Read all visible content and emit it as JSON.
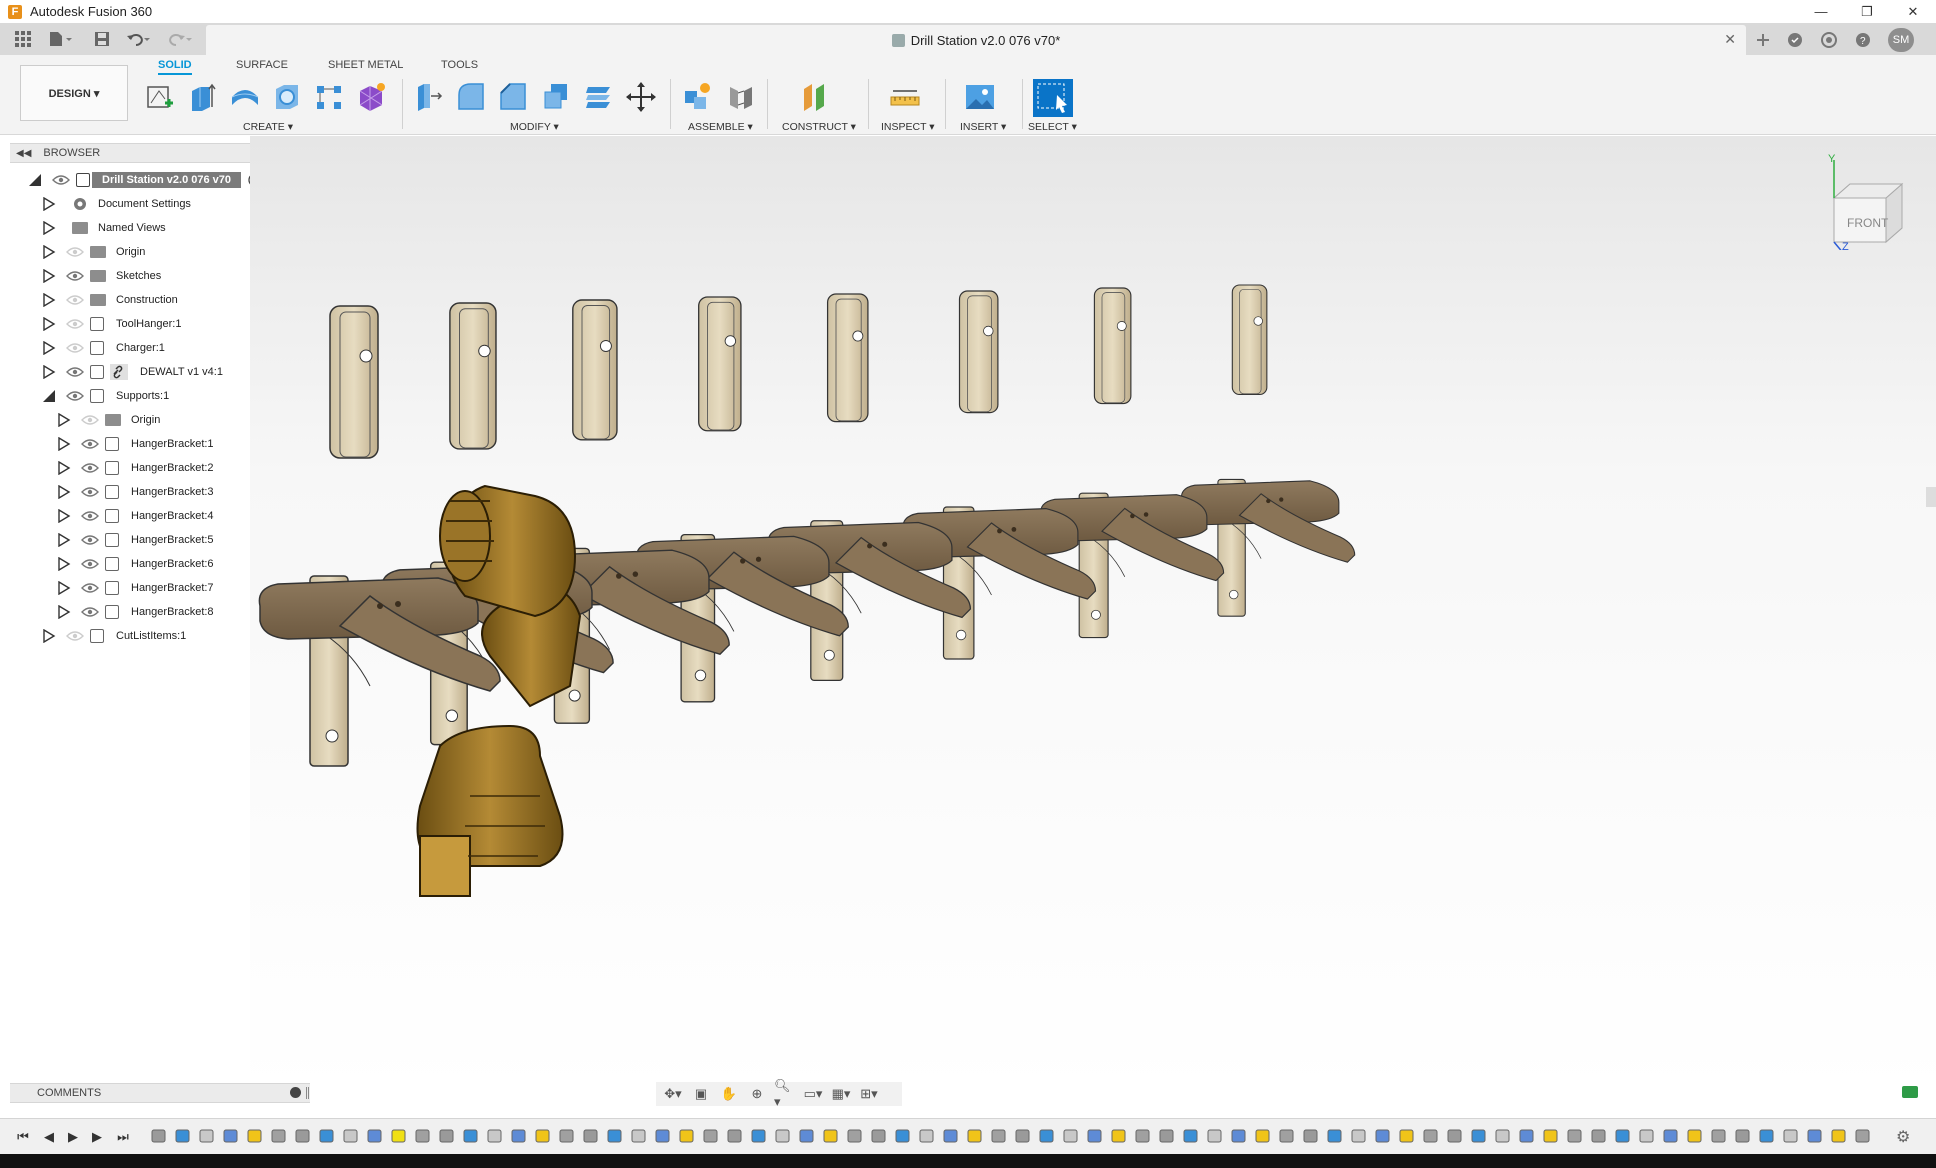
{
  "app": {
    "title": "Autodesk Fusion 360",
    "logo_letter": "F"
  },
  "document": {
    "title": "Drill Station v2.0 076 v70*",
    "close_glyph": "✕"
  },
  "user": {
    "initials": "SM"
  },
  "ribbon": {
    "workspace": "DESIGN ▾",
    "tabs": [
      "SOLID",
      "SURFACE",
      "SHEET METAL",
      "TOOLS"
    ],
    "groups": [
      "CREATE ▾",
      "MODIFY ▾",
      "ASSEMBLE ▾",
      "CONSTRUCT ▾",
      "INSPECT ▾",
      "INSERT ▾",
      "SELECT ▾"
    ]
  },
  "browser": {
    "title": "BROWSER",
    "root": "Drill Station v2.0 076 v70",
    "items": [
      {
        "label": "Document Settings",
        "icon": "gear-icon"
      },
      {
        "label": "Named Views",
        "icon": "folder-icon"
      },
      {
        "label": "Origin",
        "icon": "folder-icon"
      },
      {
        "label": "Sketches",
        "icon": "folder-icon"
      },
      {
        "label": "Construction",
        "icon": "folder-icon"
      },
      {
        "label": "ToolHanger:1",
        "icon": "component-icon"
      },
      {
        "label": "Charger:1",
        "icon": "component-icon"
      },
      {
        "label": "DEWALT v1 v4:1",
        "icon": "link-icon"
      },
      {
        "label": "Supports:1",
        "icon": "component-icon"
      },
      {
        "label": "Origin",
        "icon": "folder-icon"
      },
      {
        "label": "HangerBracket:1",
        "icon": "component-icon"
      },
      {
        "label": "HangerBracket:2",
        "icon": "component-icon"
      },
      {
        "label": "HangerBracket:3",
        "icon": "component-icon"
      },
      {
        "label": "HangerBracket:4",
        "icon": "component-icon"
      },
      {
        "label": "HangerBracket:5",
        "icon": "component-icon"
      },
      {
        "label": "HangerBracket:6",
        "icon": "component-icon"
      },
      {
        "label": "HangerBracket:7",
        "icon": "component-icon"
      },
      {
        "label": "HangerBracket:8",
        "icon": "component-icon"
      },
      {
        "label": "CutListItems:1",
        "icon": "component-icon"
      }
    ]
  },
  "viewcube": {
    "face": "FRONT",
    "axis_y": "Y",
    "axis_z": "Z"
  },
  "comments": {
    "title": "COMMENTS"
  }
}
